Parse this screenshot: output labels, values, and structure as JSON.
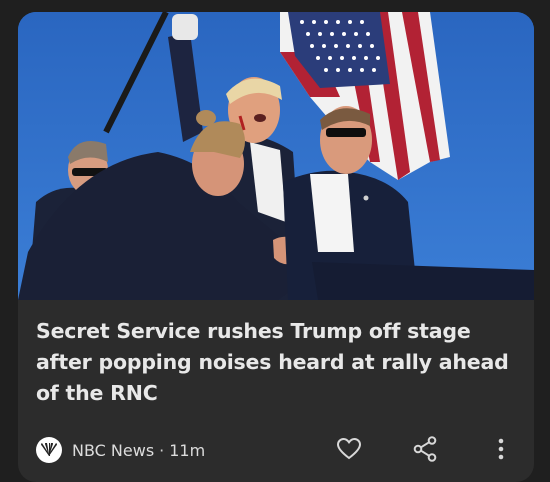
{
  "article": {
    "image_alt": "Secret Service agents surround Trump on stage with an American flag above",
    "headline": "Secret Service rushes Trump off stage after popping noises heard at rally ahead of the RNC",
    "publisher": "NBC News",
    "separator": "·",
    "age": "11m"
  },
  "actions": {
    "like_icon": "heart-icon",
    "share_icon": "share-icon",
    "more_icon": "more-vert-icon"
  },
  "colors": {
    "card_bg": "#2c2c2c",
    "page_bg": "#1f1f1f",
    "sky": "#2f6fc4",
    "text": "#e8e8e8"
  }
}
